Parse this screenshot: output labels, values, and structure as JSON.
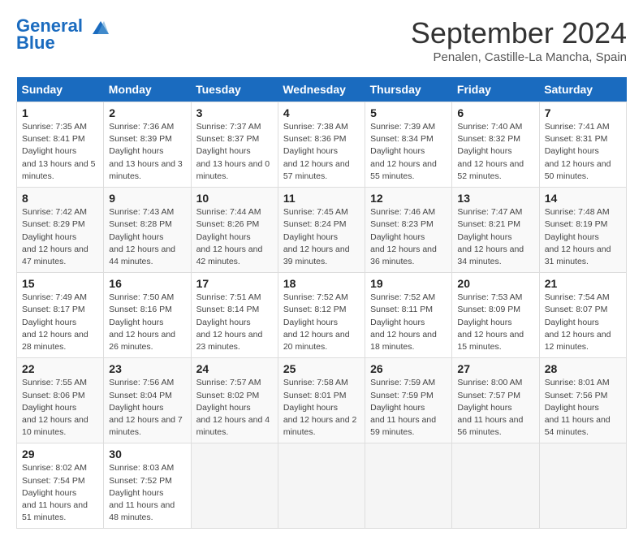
{
  "header": {
    "logo_line1": "General",
    "logo_line2": "Blue",
    "month_title": "September 2024",
    "location": "Penalen, Castille-La Mancha, Spain"
  },
  "days_of_week": [
    "Sunday",
    "Monday",
    "Tuesday",
    "Wednesday",
    "Thursday",
    "Friday",
    "Saturday"
  ],
  "weeks": [
    [
      {
        "num": "1",
        "sunrise": "7:35 AM",
        "sunset": "8:41 PM",
        "daylight": "13 hours and 5 minutes."
      },
      {
        "num": "2",
        "sunrise": "7:36 AM",
        "sunset": "8:39 PM",
        "daylight": "13 hours and 3 minutes."
      },
      {
        "num": "3",
        "sunrise": "7:37 AM",
        "sunset": "8:37 PM",
        "daylight": "13 hours and 0 minutes."
      },
      {
        "num": "4",
        "sunrise": "7:38 AM",
        "sunset": "8:36 PM",
        "daylight": "12 hours and 57 minutes."
      },
      {
        "num": "5",
        "sunrise": "7:39 AM",
        "sunset": "8:34 PM",
        "daylight": "12 hours and 55 minutes."
      },
      {
        "num": "6",
        "sunrise": "7:40 AM",
        "sunset": "8:32 PM",
        "daylight": "12 hours and 52 minutes."
      },
      {
        "num": "7",
        "sunrise": "7:41 AM",
        "sunset": "8:31 PM",
        "daylight": "12 hours and 50 minutes."
      }
    ],
    [
      {
        "num": "8",
        "sunrise": "7:42 AM",
        "sunset": "8:29 PM",
        "daylight": "12 hours and 47 minutes."
      },
      {
        "num": "9",
        "sunrise": "7:43 AM",
        "sunset": "8:28 PM",
        "daylight": "12 hours and 44 minutes."
      },
      {
        "num": "10",
        "sunrise": "7:44 AM",
        "sunset": "8:26 PM",
        "daylight": "12 hours and 42 minutes."
      },
      {
        "num": "11",
        "sunrise": "7:45 AM",
        "sunset": "8:24 PM",
        "daylight": "12 hours and 39 minutes."
      },
      {
        "num": "12",
        "sunrise": "7:46 AM",
        "sunset": "8:23 PM",
        "daylight": "12 hours and 36 minutes."
      },
      {
        "num": "13",
        "sunrise": "7:47 AM",
        "sunset": "8:21 PM",
        "daylight": "12 hours and 34 minutes."
      },
      {
        "num": "14",
        "sunrise": "7:48 AM",
        "sunset": "8:19 PM",
        "daylight": "12 hours and 31 minutes."
      }
    ],
    [
      {
        "num": "15",
        "sunrise": "7:49 AM",
        "sunset": "8:17 PM",
        "daylight": "12 hours and 28 minutes."
      },
      {
        "num": "16",
        "sunrise": "7:50 AM",
        "sunset": "8:16 PM",
        "daylight": "12 hours and 26 minutes."
      },
      {
        "num": "17",
        "sunrise": "7:51 AM",
        "sunset": "8:14 PM",
        "daylight": "12 hours and 23 minutes."
      },
      {
        "num": "18",
        "sunrise": "7:52 AM",
        "sunset": "8:12 PM",
        "daylight": "12 hours and 20 minutes."
      },
      {
        "num": "19",
        "sunrise": "7:52 AM",
        "sunset": "8:11 PM",
        "daylight": "12 hours and 18 minutes."
      },
      {
        "num": "20",
        "sunrise": "7:53 AM",
        "sunset": "8:09 PM",
        "daylight": "12 hours and 15 minutes."
      },
      {
        "num": "21",
        "sunrise": "7:54 AM",
        "sunset": "8:07 PM",
        "daylight": "12 hours and 12 minutes."
      }
    ],
    [
      {
        "num": "22",
        "sunrise": "7:55 AM",
        "sunset": "8:06 PM",
        "daylight": "12 hours and 10 minutes."
      },
      {
        "num": "23",
        "sunrise": "7:56 AM",
        "sunset": "8:04 PM",
        "daylight": "12 hours and 7 minutes."
      },
      {
        "num": "24",
        "sunrise": "7:57 AM",
        "sunset": "8:02 PM",
        "daylight": "12 hours and 4 minutes."
      },
      {
        "num": "25",
        "sunrise": "7:58 AM",
        "sunset": "8:01 PM",
        "daylight": "12 hours and 2 minutes."
      },
      {
        "num": "26",
        "sunrise": "7:59 AM",
        "sunset": "7:59 PM",
        "daylight": "11 hours and 59 minutes."
      },
      {
        "num": "27",
        "sunrise": "8:00 AM",
        "sunset": "7:57 PM",
        "daylight": "11 hours and 56 minutes."
      },
      {
        "num": "28",
        "sunrise": "8:01 AM",
        "sunset": "7:56 PM",
        "daylight": "11 hours and 54 minutes."
      }
    ],
    [
      {
        "num": "29",
        "sunrise": "8:02 AM",
        "sunset": "7:54 PM",
        "daylight": "11 hours and 51 minutes."
      },
      {
        "num": "30",
        "sunrise": "8:03 AM",
        "sunset": "7:52 PM",
        "daylight": "11 hours and 48 minutes."
      },
      null,
      null,
      null,
      null,
      null
    ]
  ]
}
